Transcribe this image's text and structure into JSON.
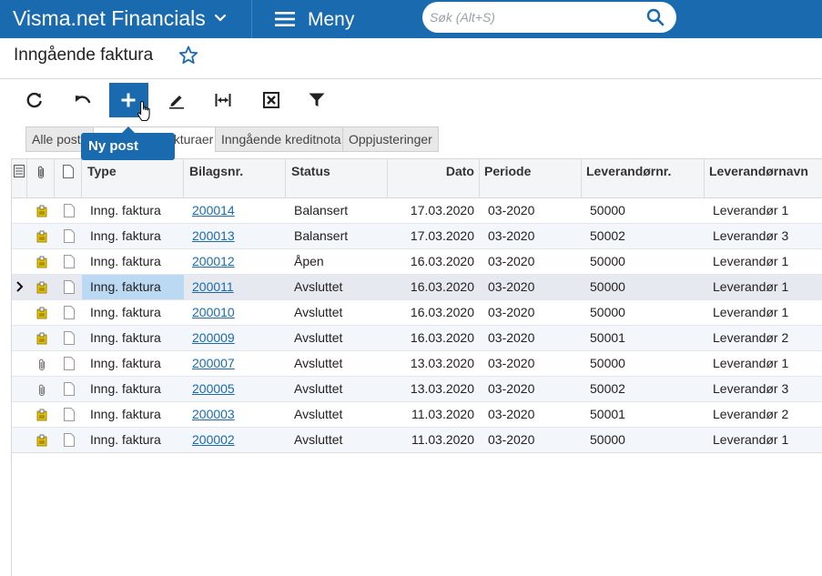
{
  "topbar": {
    "app_title": "Visma.net Financials",
    "menu_label": "Meny",
    "search_placeholder": "Søk (Alt+S)"
  },
  "page": {
    "title": "Inngående faktura"
  },
  "toolbar": {
    "buttons": [
      "refresh-icon",
      "undo-icon",
      "add-icon",
      "edit-icon",
      "fit-columns-icon",
      "export-excel-icon",
      "filter-icon"
    ],
    "tooltip": "Ny post"
  },
  "tabs": [
    {
      "label": "Alle poster"
    },
    {
      "label": "Inngående fakturaer"
    },
    {
      "label": "Inngående kreditnota"
    },
    {
      "label": "Oppjusteringer"
    }
  ],
  "grid": {
    "columns": [
      "Type",
      "Bilagsnr.",
      "Status",
      "Dato",
      "Periode",
      "Leverandørnr.",
      "Leverandørnavn"
    ],
    "rows": [
      {
        "attach": "note",
        "type": "Inng. faktura",
        "ref": "200014",
        "status": "Balansert",
        "date": "17.03.2020",
        "period": "03-2020",
        "vendor_id": "50000",
        "vendor_name": "Leverandør 1"
      },
      {
        "attach": "note",
        "type": "Inng. faktura",
        "ref": "200013",
        "status": "Balansert",
        "date": "17.03.2020",
        "period": "03-2020",
        "vendor_id": "50002",
        "vendor_name": "Leverandør 3"
      },
      {
        "attach": "note",
        "type": "Inng. faktura",
        "ref": "200012",
        "status": "Åpen",
        "date": "16.03.2020",
        "period": "03-2020",
        "vendor_id": "50000",
        "vendor_name": "Leverandør 1"
      },
      {
        "attach": "note",
        "type": "Inng. faktura",
        "ref": "200011",
        "status": "Avsluttet",
        "date": "16.03.2020",
        "period": "03-2020",
        "vendor_id": "50000",
        "vendor_name": "Leverandør 1",
        "selected": true
      },
      {
        "attach": "note",
        "type": "Inng. faktura",
        "ref": "200010",
        "status": "Avsluttet",
        "date": "16.03.2020",
        "period": "03-2020",
        "vendor_id": "50000",
        "vendor_name": "Leverandør 1"
      },
      {
        "attach": "note",
        "type": "Inng. faktura",
        "ref": "200009",
        "status": "Avsluttet",
        "date": "16.03.2020",
        "period": "03-2020",
        "vendor_id": "50001",
        "vendor_name": "Leverandør 2"
      },
      {
        "attach": "clip",
        "type": "Inng. faktura",
        "ref": "200007",
        "status": "Avsluttet",
        "date": "13.03.2020",
        "period": "03-2020",
        "vendor_id": "50000",
        "vendor_name": "Leverandør 1"
      },
      {
        "attach": "clip",
        "type": "Inng. faktura",
        "ref": "200005",
        "status": "Avsluttet",
        "date": "13.03.2020",
        "period": "03-2020",
        "vendor_id": "50002",
        "vendor_name": "Leverandør 3"
      },
      {
        "attach": "note",
        "type": "Inng. faktura",
        "ref": "200003",
        "status": "Avsluttet",
        "date": "11.03.2020",
        "period": "03-2020",
        "vendor_id": "50001",
        "vendor_name": "Leverandør 2"
      },
      {
        "attach": "note",
        "type": "Inng. faktura",
        "ref": "200002",
        "status": "Avsluttet",
        "date": "11.03.2020",
        "period": "03-2020",
        "vendor_id": "50000",
        "vendor_name": "Leverandør 1"
      }
    ]
  },
  "colors": {
    "brand": "#1a6ab0",
    "link": "#1a6ab0",
    "selected_cell": "#bcd9f3",
    "note_icon": "#e8c400"
  }
}
